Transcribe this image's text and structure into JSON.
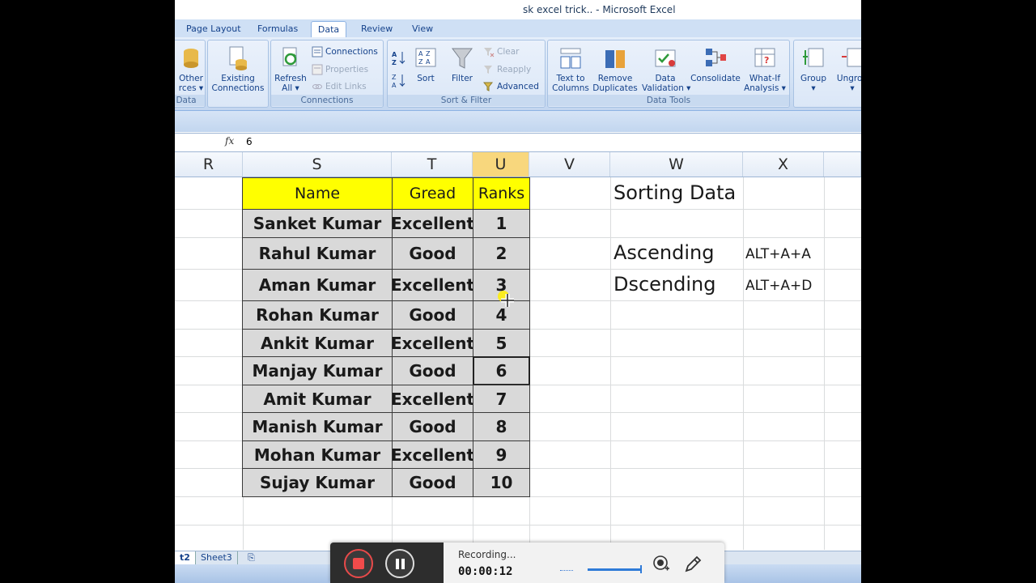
{
  "window": {
    "title": "sk excel trick.. - Microsoft Excel"
  },
  "tabs": [
    {
      "label": "Page Layout"
    },
    {
      "label": "Formulas"
    },
    {
      "label": "Data"
    },
    {
      "label": "Review"
    },
    {
      "label": "View"
    }
  ],
  "ribbon": {
    "get_external": {
      "label_line1": "Other",
      "label_line2": "rces ▾",
      "group_label": "Data"
    },
    "existing": {
      "label_line1": "Existing",
      "label_line2": "Connections"
    },
    "connections": {
      "refresh_line1": "Refresh",
      "refresh_line2": "All ▾",
      "connections": "Connections",
      "properties": "Properties",
      "edit_links": "Edit Links",
      "group_label": "Connections"
    },
    "sort_filter": {
      "sort": "Sort",
      "filter": "Filter",
      "clear": "Clear",
      "reapply": "Reapply",
      "advanced": "Advanced",
      "group_label": "Sort & Filter"
    },
    "data_tools": {
      "text_to_columns_line1": "Text to",
      "text_to_columns_line2": "Columns",
      "remove_dup_line1": "Remove",
      "remove_dup_line2": "Duplicates",
      "validation_line1": "Data",
      "validation_line2": "Validation ▾",
      "consolidate": "Consolidate",
      "whatif_line1": "What-If",
      "whatif_line2": "Analysis ▾",
      "group_label": "Data Tools"
    },
    "outline": {
      "group": "Group",
      "ungroup": "Ungrou"
    }
  },
  "formula_bar": {
    "fx": "fx",
    "value": "6"
  },
  "columns": [
    "R",
    "S",
    "T",
    "U",
    "V",
    "W",
    "X"
  ],
  "table": {
    "headers": {
      "name": "Name",
      "grade": "Gread",
      "rank": "Ranks"
    },
    "rows": [
      {
        "name": "Sanket Kumar",
        "grade": "Excellent",
        "rank": "1"
      },
      {
        "name": "Rahul Kumar",
        "grade": "Good",
        "rank": "2"
      },
      {
        "name": "Aman Kumar",
        "grade": "Excellent",
        "rank": "3"
      },
      {
        "name": "Rohan Kumar",
        "grade": "Good",
        "rank": "4"
      },
      {
        "name": "Ankit Kumar",
        "grade": "Excellent",
        "rank": "5"
      },
      {
        "name": "Manjay Kumar",
        "grade": "Good",
        "rank": "6"
      },
      {
        "name": "Amit Kumar",
        "grade": "Excellent",
        "rank": "7"
      },
      {
        "name": "Manish Kumar",
        "grade": "Good",
        "rank": "8"
      },
      {
        "name": "Mohan Kumar",
        "grade": "Excellent",
        "rank": "9"
      },
      {
        "name": "Sujay Kumar",
        "grade": "Good",
        "rank": "10"
      }
    ]
  },
  "notes": {
    "title": "Sorting Data",
    "ascending": "Ascending",
    "ascending_key": "ALT+A+A",
    "descending": "Dscending",
    "descending_key": "ALT+A+D"
  },
  "sheets": [
    {
      "label": "t2"
    },
    {
      "label": "Sheet3"
    }
  ],
  "recorder": {
    "status": "Recording...",
    "time": "00:00:12"
  },
  "colors": {
    "header_fill": "#ffff00",
    "data_fill": "#d9d9d9",
    "active_col": "#f8d77d",
    "stop": "#f04b4b"
  }
}
